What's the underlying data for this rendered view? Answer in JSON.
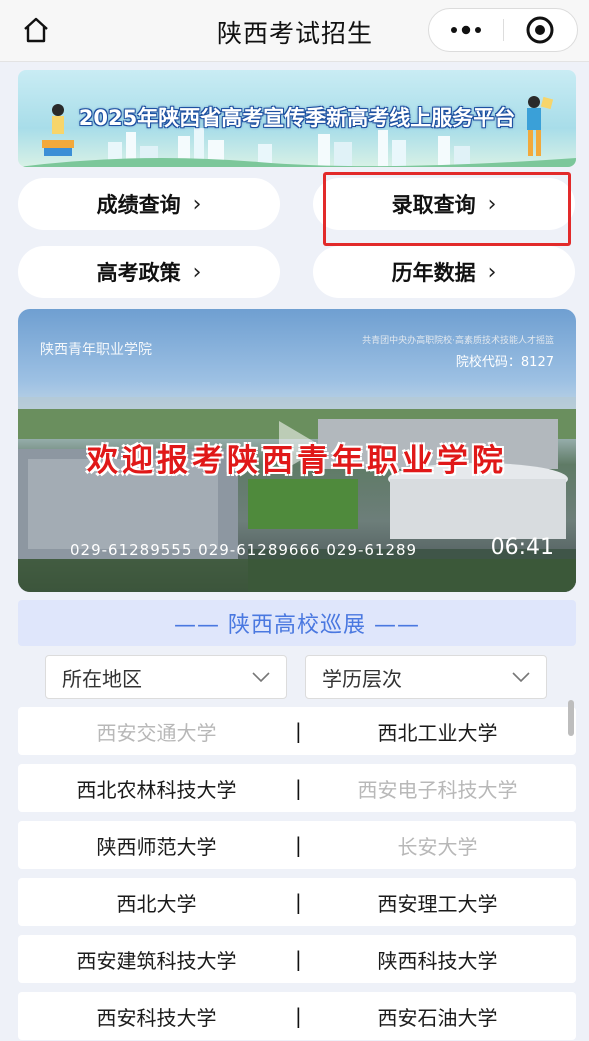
{
  "header": {
    "title": "陕西考试招生",
    "home_icon": "home-icon",
    "more_icon": "more-icon",
    "close_icon": "target-icon"
  },
  "banner": {
    "title": "2025年陕西省高考宣传季新高考线上服务平台"
  },
  "quick_links": [
    {
      "label": "成绩查询",
      "chevron": "›"
    },
    {
      "label": "录取查询",
      "chevron": "›"
    },
    {
      "label": "高考政策",
      "chevron": "›"
    },
    {
      "label": "历年数据",
      "chevron": "›"
    }
  ],
  "video": {
    "logo_text": "陕西青年职业学院",
    "school_tag": "共青团中央办高职院校·高素质技术技能人才摇篮",
    "school_code": "院校代码：8127",
    "welcome": "欢迎报考陕西青年职业学院",
    "phones": "029-61289555   029-61289666   029-61289",
    "duration": "06:41"
  },
  "section": {
    "title": "—— 陕西高校巡展 ——"
  },
  "filters": {
    "region": "所在地区",
    "level": "学历层次"
  },
  "universities": [
    {
      "left": "西安交通大学",
      "left_dim": true,
      "sep": "|",
      "right": "西北工业大学",
      "right_dim": false
    },
    {
      "left": "西北农林科技大学",
      "left_dim": false,
      "sep": "|",
      "right": "西安电子科技大学",
      "right_dim": true
    },
    {
      "left": "陕西师范大学",
      "left_dim": false,
      "sep": "|",
      "right": "长安大学",
      "right_dim": true
    },
    {
      "left": "西北大学",
      "left_dim": false,
      "sep": "|",
      "right": "西安理工大学",
      "right_dim": false
    },
    {
      "left": "西安建筑科技大学",
      "left_dim": false,
      "sep": "|",
      "right": "陕西科技大学",
      "right_dim": false
    },
    {
      "left": "西安科技大学",
      "left_dim": false,
      "sep": "|",
      "right": "西安石油大学",
      "right_dim": false
    }
  ]
}
